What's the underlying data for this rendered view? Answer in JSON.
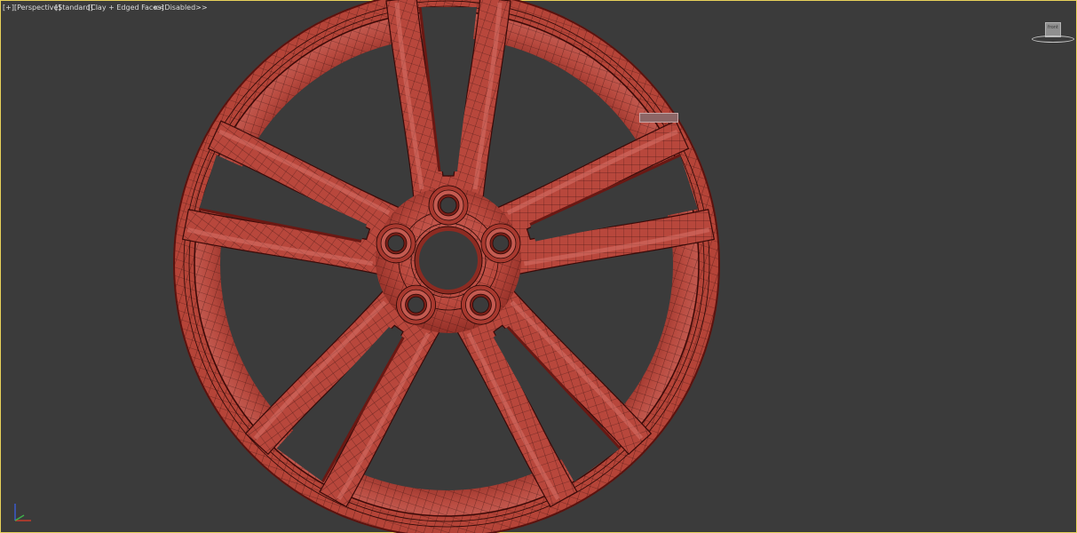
{
  "viewport": {
    "labels": {
      "menu": "[+]",
      "view": "[Perspective]",
      "shading_preset": "[Standard]",
      "visual_style": "[Clay + Edged Faces]",
      "camera_mode": "<<Disabled>>"
    },
    "viewcube": {
      "face": "front"
    },
    "pivot_tag": "",
    "axis_tripod": {
      "x_label": "x",
      "y_label": "y",
      "z_label": "z"
    }
  },
  "scene": {
    "object": "wheel-rim",
    "spoke_pairs": 5,
    "lug_holes": 5
  },
  "colors": {
    "background": "#3b3b3b",
    "active_border": "#e8d25a",
    "rim_base": "#b34035",
    "rim_light": "#c85a50",
    "rim_shadow": "#6a1813",
    "wire": "#1d0706",
    "label_text": "#dcdcdc"
  }
}
